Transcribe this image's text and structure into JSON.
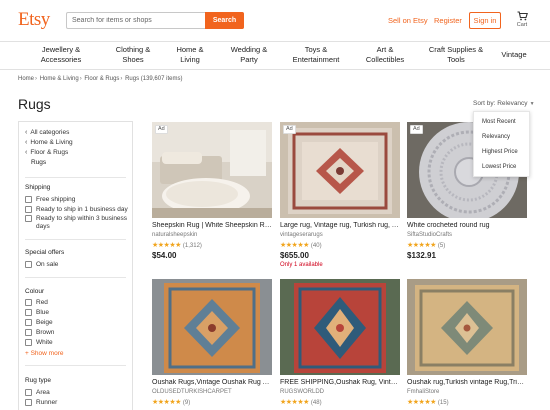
{
  "header": {
    "logo": "Etsy",
    "search_placeholder": "Search for items or shops",
    "search_button": "Search",
    "sell": "Sell on Etsy",
    "register": "Register",
    "signin": "Sign in",
    "cart": "Cart"
  },
  "categories": [
    {
      "line1": "Jewellery &",
      "line2": "Accessories"
    },
    {
      "line1": "Clothing &",
      "line2": "Shoes"
    },
    {
      "line1": "Home &",
      "line2": "Living"
    },
    {
      "line1": "Wedding &",
      "line2": "Party"
    },
    {
      "line1": "Toys &",
      "line2": "Entertainment"
    },
    {
      "line1": "Art &",
      "line2": "Collectibles"
    },
    {
      "line1": "Craft Supplies &",
      "line2": "Tools"
    },
    {
      "line1": "Vintage",
      "line2": ""
    }
  ],
  "breadcrumb": [
    "Home",
    "Home & Living",
    "Floor & Rugs",
    "Rugs (139,607 items)"
  ],
  "page_title": "Rugs",
  "sort": {
    "label": "Sort by: Relevancy",
    "options": [
      "Most Recent",
      "Relevancy",
      "Highest Price",
      "Lowest Price"
    ]
  },
  "sidebar": {
    "nav": [
      "All categories",
      "Home & Living",
      "Floor & Rugs"
    ],
    "current": "Rugs",
    "shipping_title": "Shipping",
    "shipping": [
      "Free shipping",
      "Ready to ship in 1 business day",
      "Ready to ship within 3 business",
      "days"
    ],
    "offers_title": "Special offers",
    "offers": [
      "On sale"
    ],
    "colour_title": "Colour",
    "colours": [
      "Red",
      "Blue",
      "Beige",
      "Brown",
      "White"
    ],
    "show_more": "+ Show more",
    "rugtype_title": "Rug type",
    "rugtypes": [
      "Area",
      "Runner"
    ]
  },
  "listings": [
    {
      "ad": "Ad",
      "title": "Sheepskin Rug | White Sheepskin Rug",
      "shop": "naturalsheepskin",
      "stars": "★★★★★",
      "count": "(1,312)",
      "price": "$54.00",
      "note": ""
    },
    {
      "ad": "Ad",
      "title": "Large rug, Vintage rug, Turkish rug, Area rug",
      "shop": "vintageserarugs",
      "stars": "★★★★★",
      "count": "(40)",
      "price": "$655.00",
      "note": "Only 1 available"
    },
    {
      "ad": "Ad",
      "title": "White crocheted round rug",
      "shop": "SiftaStudioCrafts",
      "stars": "★★★★★",
      "count": "(5)",
      "price": "$132.91",
      "note": ""
    },
    {
      "ad": "",
      "title": "Oushak Rugs,Vintage Oushak Rug Area Rug",
      "shop": "OLDUSEDTURKISHCARPET",
      "stars": "★★★★★",
      "count": "(9)",
      "price": "",
      "note": ""
    },
    {
      "ad": "",
      "title": "FREE SHIPPING,Oushak Rug, Vintage Rug",
      "shop": "RUGSWORLDD",
      "stars": "★★★★★",
      "count": "(48)",
      "price": "",
      "note": ""
    },
    {
      "ad": "",
      "title": "Oushak rug,Turkish vintage Rug,Tribal Rug",
      "shop": "FmhaliStore",
      "stars": "★★★★★",
      "count": "(15)",
      "price": "",
      "note": ""
    }
  ],
  "colors": {
    "accent": "#F1641E",
    "star": "#F1A51E",
    "alert": "#D0021B"
  }
}
